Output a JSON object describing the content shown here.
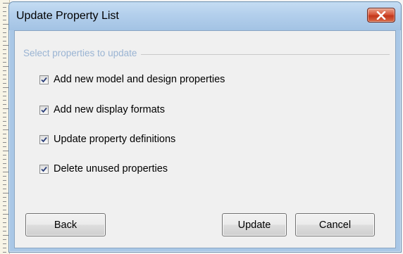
{
  "dialog": {
    "title": "Update Property List",
    "close_icon": "close-icon",
    "close_color": "#c7432a"
  },
  "group": {
    "label": "Select properties to update",
    "label_color": "#9ab4d3"
  },
  "options": [
    {
      "label": "Add new model and design properties",
      "checked": true
    },
    {
      "label": "Add new display formats",
      "checked": true
    },
    {
      "label": "Update property definitions",
      "checked": true
    },
    {
      "label": "Delete unused properties",
      "checked": true
    }
  ],
  "buttons": {
    "back": "Back",
    "update": "Update",
    "cancel": "Cancel"
  }
}
